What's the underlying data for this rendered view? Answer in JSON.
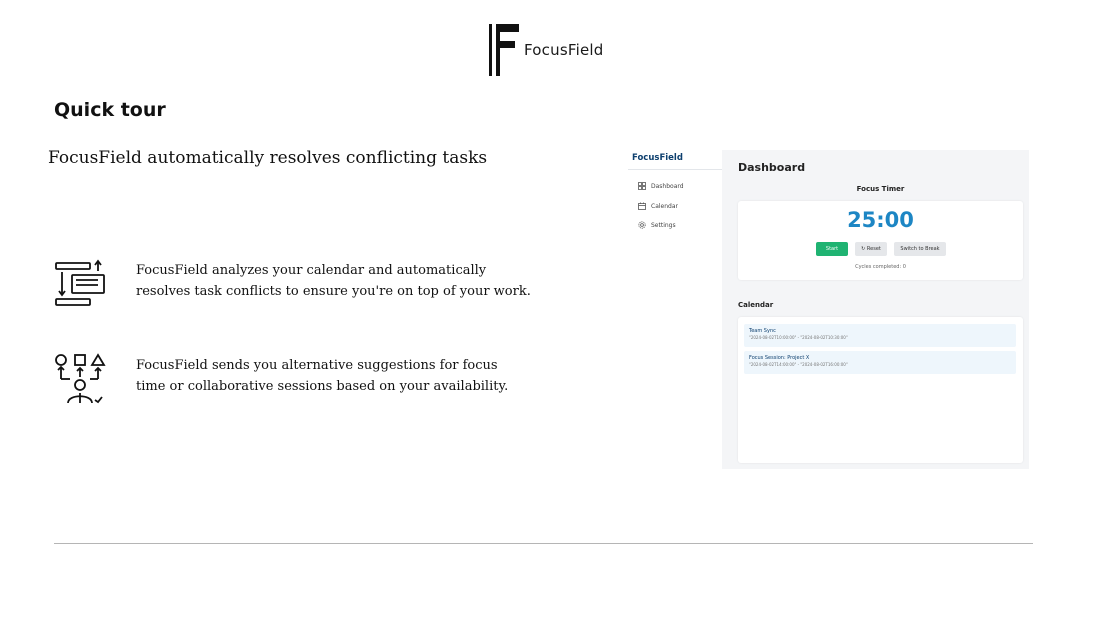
{
  "brand": {
    "name": "FocusField"
  },
  "tour": {
    "heading": "Quick tour",
    "section_title": "FocusField automatically resolves conflicting tasks",
    "features": [
      {
        "icon": "resolve-tasks-icon",
        "text": "FocusField analyzes your calendar and automatically resolves task conflicts to ensure you're on top of your work."
      },
      {
        "icon": "collaboration-suggestions-icon",
        "text": "FocusField sends you alternative suggestions for focus time or collaborative sessions based on your availability."
      }
    ]
  },
  "app": {
    "brand": "FocusField",
    "nav": [
      {
        "label": "Dashboard",
        "icon": "dashboard-icon"
      },
      {
        "label": "Calendar",
        "icon": "calendar-icon"
      },
      {
        "label": "Settings",
        "icon": "settings-icon"
      }
    ],
    "page_title": "Dashboard",
    "timer": {
      "label": "Focus Timer",
      "value": "25:00",
      "start": "Start",
      "reset": "Reset",
      "switch": "Switch to Break",
      "cycles": "Cycles completed: 0"
    },
    "calendar": {
      "label": "Calendar",
      "events": [
        {
          "title": "Team Sync",
          "time": "\"2024-08-02T10:00:00\" - \"2024-08-02T10:30:00\""
        },
        {
          "title": "Focus Session: Project X",
          "time": "\"2024-08-02T14:00:00\" - \"2024-08-02T16:00:00\""
        }
      ]
    }
  },
  "colors": {
    "accent_blue": "#1d86c4",
    "start_green": "#1fb372",
    "brand_navy": "#0d3f6e"
  }
}
